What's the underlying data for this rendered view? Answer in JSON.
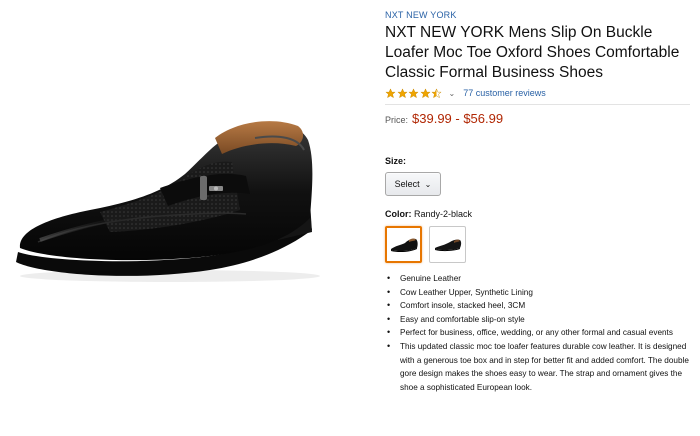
{
  "product": {
    "brand": "NXT NEW YORK",
    "title_lines": [
      "NXT NEW YORK Mens Slip On Buckle",
      "Loafer Moc Toe Oxford Shoes Comfortable",
      "Classic Formal Business Shoes"
    ],
    "rating": 4.5,
    "reviews_text": "77 customer reviews",
    "price_label": "Price:",
    "price_value": "$39.99 - $56.99",
    "size_label": "Size:",
    "size_select": "Select",
    "color_label": "Color:",
    "color_value": "Randy-2-black",
    "swatches": [
      "Randy-2-black",
      "black"
    ],
    "bullets": [
      "Genuine Leather",
      "Cow Leather Upper, Synthetic Lining",
      "Comfort insole, stacked heel, 3CM",
      "Easy and comfortable slip-on style",
      "Perfect for business, office, wedding, or any other formal and casual events",
      "This updated classic moc toe loafer features durable cow leather. It is designed with a generous toe box and in step for better fit and added comfort. The double gore design makes the shoes easy to wear. The strap and ornament gives the shoe a sophisticated European look."
    ]
  },
  "colors": {
    "link": "#2a62a6",
    "price": "#b12704",
    "star": "#f0a500",
    "selected_border": "#e77600"
  }
}
